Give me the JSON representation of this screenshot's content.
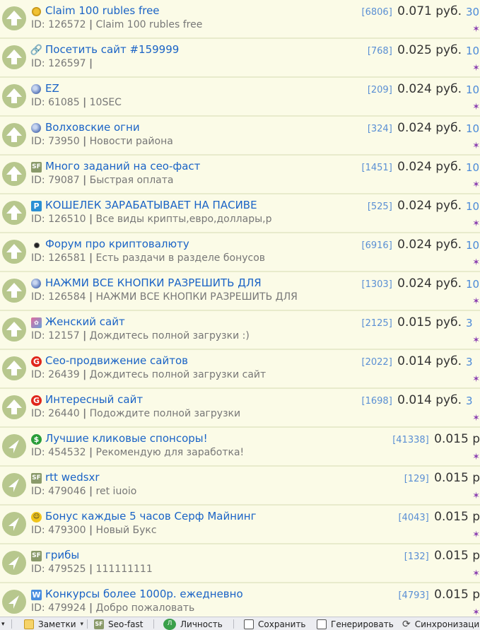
{
  "rows": [
    {
      "icon": "coin-icon",
      "title": "Claim 100 rubles free",
      "id_label": "ID: 126572",
      "desc": "Claim 100 rubles free",
      "count": "[6806]",
      "price": "0.071 руб.",
      "rate": "30",
      "star": "✶"
    },
    {
      "icon": "link-icon",
      "title": "Посетить сайт #159999",
      "id_label": "ID: 126597",
      "desc": "",
      "count": "[768]",
      "price": "0.025 руб.",
      "rate": "10",
      "star": "✶"
    },
    {
      "icon": "globe-icon",
      "title": "EZ",
      "id_label": "ID: 61085",
      "desc": "10SEC",
      "count": "[209]",
      "price": "0.024 руб.",
      "rate": "10",
      "star": "✶"
    },
    {
      "icon": "globe-icon",
      "title": "Волховские огни",
      "id_label": "ID: 73950",
      "desc": "Новости района",
      "count": "[324]",
      "price": "0.024 руб.",
      "rate": "10",
      "star": "✶"
    },
    {
      "icon": "seofast-icon",
      "title": "Много заданий на сео-фаст",
      "id_label": "ID: 79087",
      "desc": "Быстрая оплата",
      "count": "[1451]",
      "price": "0.024 руб.",
      "rate": "10",
      "star": "✶"
    },
    {
      "icon": "p-icon",
      "title": "КОШЕЛЕК ЗАРАБАТЫВАЕТ НА ПАСИВЕ",
      "id_label": "ID: 126510",
      "desc": "Все виды крипты,евро,доллары,р",
      "count": "[525]",
      "price": "0.024 руб.",
      "rate": "10",
      "star": "✶"
    },
    {
      "icon": "small-coin-icon",
      "title": "Форум про криптовалюту",
      "id_label": "ID: 126581",
      "desc": "Есть раздачи в разделе бонусов",
      "count": "[6916]",
      "price": "0.024 руб.",
      "rate": "10",
      "star": "✶"
    },
    {
      "icon": "globe-icon",
      "title": "НАЖМИ ВСЕ КНОПКИ РАЗРЕШИТЬ ДЛЯ",
      "id_label": "ID: 126584",
      "desc": "НАЖМИ ВСЕ КНОПКИ РАЗРЕШИТЬ ДЛЯ",
      "count": "[1303]",
      "price": "0.024 руб.",
      "rate": "10",
      "star": "✶"
    },
    {
      "icon": "flower-icon",
      "title": "Женский сайт",
      "id_label": "ID: 12157",
      "desc": "Дождитесь полной загрузки :)",
      "count": "[2125]",
      "price": "0.015 руб.",
      "rate": "3",
      "star": "✶"
    },
    {
      "icon": "red-g-icon",
      "title": "Сео-продвижение сайтов",
      "id_label": "ID: 26439",
      "desc": "Дождитесь полной загрузки сайт",
      "count": "[2022]",
      "price": "0.014 руб.",
      "rate": "3",
      "star": "✶"
    },
    {
      "icon": "red-g-icon",
      "title": "Интересный сайт",
      "id_label": "ID: 26440",
      "desc": "Подождите полной загрузки",
      "count": "[1698]",
      "price": "0.014 руб.",
      "rate": "3",
      "star": "✶"
    },
    {
      "icon": "dollar-icon",
      "title": "Лучшие кликовые спонсоры!",
      "id_label": "ID: 454532",
      "desc": "Рекомендую для заработка!",
      "count": "[41338]",
      "price": "0.015 р",
      "rate": "",
      "star": "✶"
    },
    {
      "icon": "seofast-icon",
      "title": "rtt wedsxr",
      "id_label": "ID: 479046",
      "desc": "ret iuoio",
      "count": "[129]",
      "price": "0.015 р",
      "rate": "",
      "star": "✶"
    },
    {
      "icon": "emoji-icon",
      "title": "Бонус каждые 5 часов Серф Майнинг",
      "id_label": "ID: 479300",
      "desc": "Новый Букс",
      "count": "[4043]",
      "price": "0.015 р",
      "rate": "",
      "star": "✶"
    },
    {
      "icon": "seofast-icon",
      "title": "грибы",
      "id_label": "ID: 479525",
      "desc": "111111111",
      "count": "[132]",
      "price": "0.015 р",
      "rate": "",
      "star": "✶"
    },
    {
      "icon": "w-icon",
      "title": "Конкурсы более 1000р. ежедневно",
      "id_label": "ID: 479924",
      "desc": "Добро пожаловать",
      "count": "[4793]",
      "price": "0.015 р",
      "rate": "",
      "star": "✶"
    }
  ],
  "toolbar": {
    "notes": "Заметки",
    "seofast": "Seo-fast",
    "personal": "Личность",
    "save": "Сохранить",
    "generate": "Генерировать",
    "sync": "Синхронизация"
  }
}
